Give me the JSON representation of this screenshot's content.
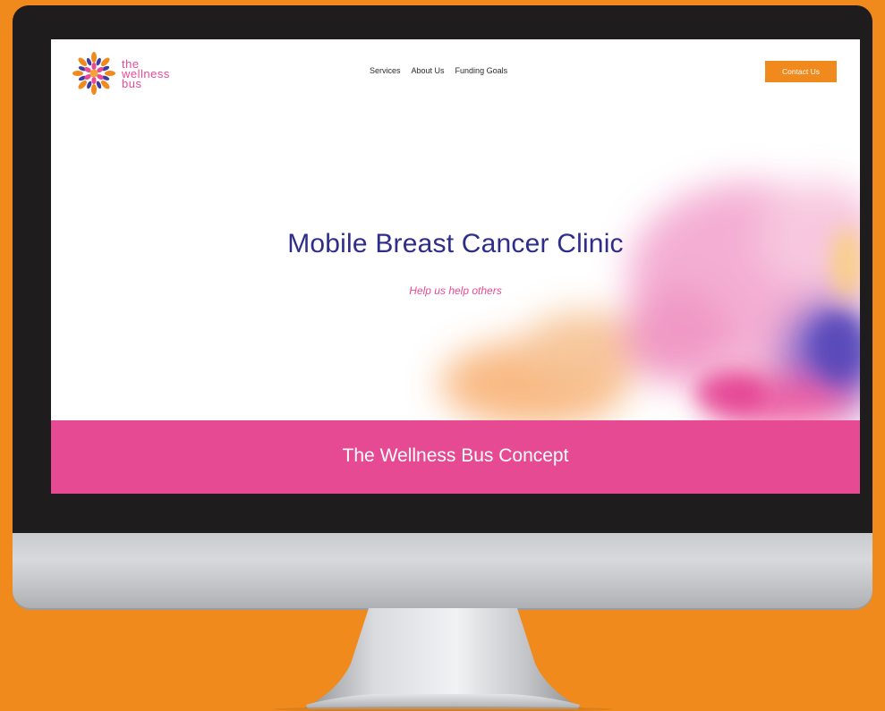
{
  "brand": {
    "logo_lines": [
      "the",
      "wellness",
      "bus"
    ]
  },
  "nav": {
    "items": [
      "Services",
      "About Us",
      "Funding Goals"
    ],
    "contact_label": "Contact Us"
  },
  "hero": {
    "title": "Mobile Breast Cancer Clinic",
    "subtitle": "Help us help others"
  },
  "section": {
    "title": "The Wellness Bus Concept"
  },
  "colors": {
    "background": "#f08a1c",
    "primary_pink": "#e64a92",
    "heading_navy": "#2e2d8a",
    "button_orange": "#f08a1c"
  }
}
